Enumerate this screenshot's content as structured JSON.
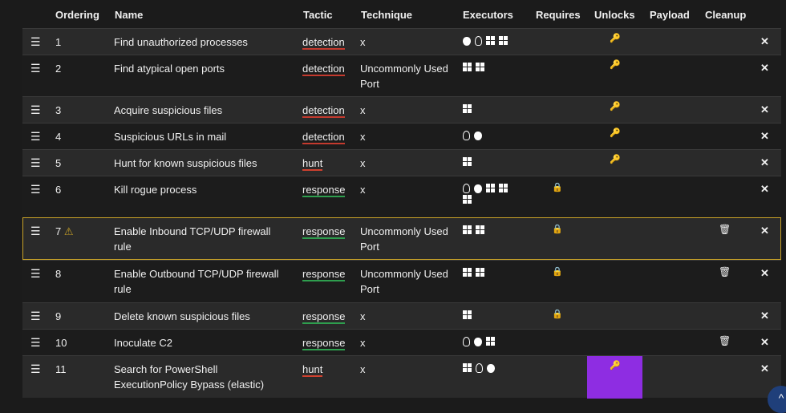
{
  "headers": {
    "ordering": "Ordering",
    "name": "Name",
    "tactic": "Tactic",
    "technique": "Technique",
    "executors": "Executors",
    "requires": "Requires",
    "unlocks": "Unlocks",
    "payload": "Payload",
    "cleanup": "Cleanup"
  },
  "icons": {
    "handle": "☰",
    "close": "✕",
    "key": "🔑",
    "lock": "🔒",
    "trash": "🗑",
    "warning": "⚠",
    "chevron_up": "^"
  },
  "colors": {
    "detection": "#c43a2e",
    "hunt": "#d0412f",
    "response": "#2e9e4e",
    "highlight": "#8e2de2",
    "warning_border": "#c9a227"
  },
  "rows": [
    {
      "order": "1",
      "name": "Find unauthorized processes",
      "tactic": "detection",
      "technique": "x",
      "executors": [
        "apple",
        "linux",
        "windows",
        "windows"
      ],
      "requires": false,
      "unlocks": true,
      "cleanup": false
    },
    {
      "order": "2",
      "name": "Find atypical open ports",
      "tactic": "detection",
      "technique": "Uncommonly Used Port",
      "executors": [
        "windows",
        "windows"
      ],
      "requires": false,
      "unlocks": true,
      "cleanup": false
    },
    {
      "order": "3",
      "name": "Acquire suspicious files",
      "tactic": "detection",
      "technique": "x",
      "executors": [
        "windows"
      ],
      "requires": false,
      "unlocks": true,
      "cleanup": false
    },
    {
      "order": "4",
      "name": "Suspicious URLs in mail",
      "tactic": "detection",
      "technique": "x",
      "executors": [
        "linux",
        "apple"
      ],
      "requires": false,
      "unlocks": true,
      "cleanup": false
    },
    {
      "order": "5",
      "name": "Hunt for known suspicious files",
      "tactic": "hunt",
      "technique": "x",
      "executors": [
        "windows"
      ],
      "requires": false,
      "unlocks": true,
      "cleanup": false
    },
    {
      "order": "6",
      "name": "Kill rogue process",
      "tactic": "response",
      "technique": "x",
      "executors": [
        "linux",
        "apple",
        "windows",
        "windows",
        "windows"
      ],
      "requires": true,
      "unlocks": false,
      "cleanup": false
    },
    {
      "order": "7",
      "name": "Enable Inbound TCP/UDP firewall rule",
      "tactic": "response",
      "technique": "Uncommonly Used Port",
      "executors": [
        "windows",
        "windows"
      ],
      "requires": true,
      "unlocks": false,
      "cleanup": true,
      "warning": true
    },
    {
      "order": "8",
      "name": "Enable Outbound TCP/UDP firewall rule",
      "tactic": "response",
      "technique": "Uncommonly Used Port",
      "executors": [
        "windows",
        "windows"
      ],
      "requires": true,
      "unlocks": false,
      "cleanup": true
    },
    {
      "order": "9",
      "name": "Delete known suspicious files",
      "tactic": "response",
      "technique": "x",
      "executors": [
        "windows"
      ],
      "requires": true,
      "unlocks": false,
      "cleanup": false
    },
    {
      "order": "10",
      "name": "Inoculate C2",
      "tactic": "response",
      "technique": "x",
      "executors": [
        "linux",
        "apple",
        "windows"
      ],
      "requires": false,
      "unlocks": false,
      "cleanup": true
    },
    {
      "order": "11",
      "name": "Search for PowerShell ExecutionPolicy Bypass (elastic)",
      "tactic": "hunt",
      "technique": "x",
      "executors": [
        "windows",
        "linux",
        "apple"
      ],
      "requires": false,
      "unlocks": true,
      "cleanup": false,
      "unlock_highlight": true
    }
  ]
}
